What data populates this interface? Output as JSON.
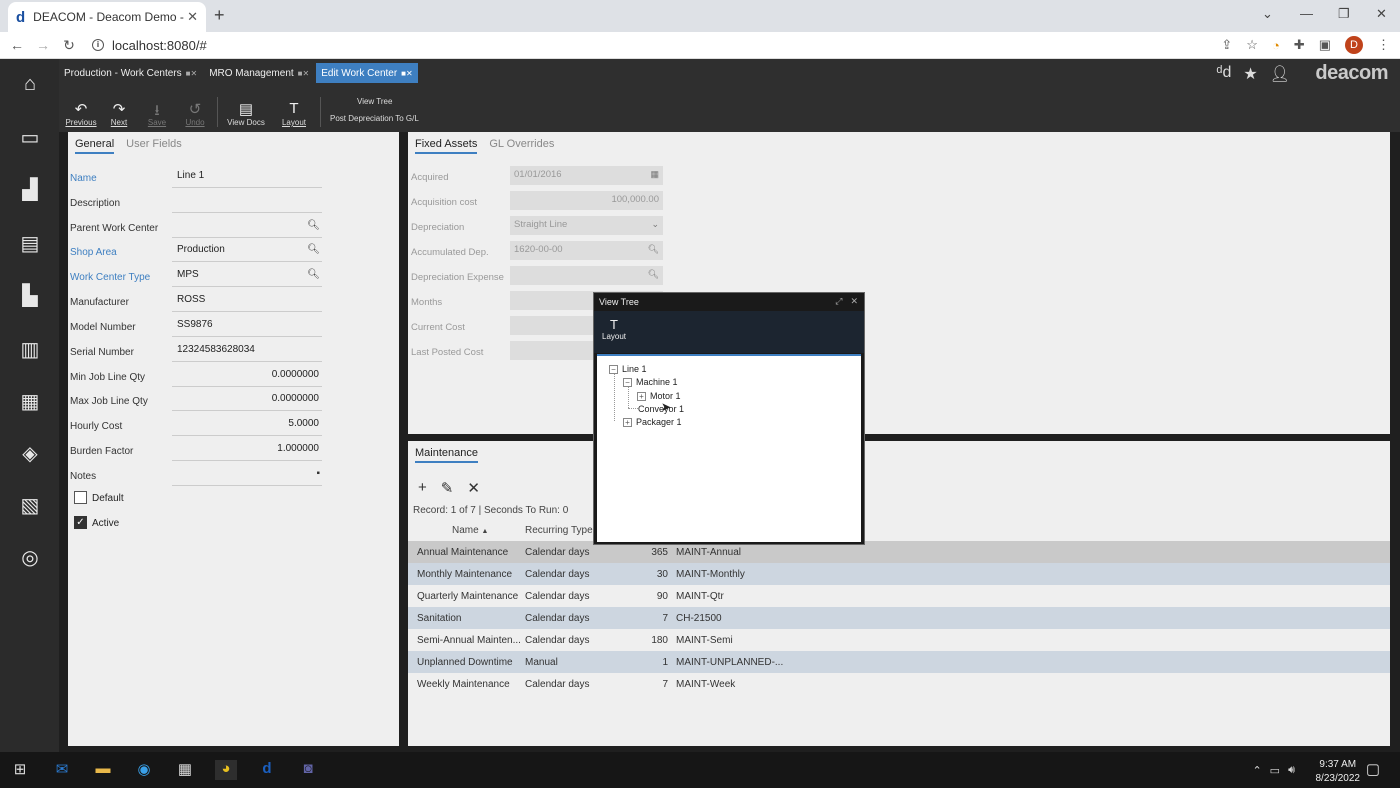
{
  "browser": {
    "tab_title": "DEACOM - Deacom Demo - Edit",
    "favicon_letter": "d",
    "url": "localhost:8080/#",
    "profile_initial": "D"
  },
  "app": {
    "brand": "deacom",
    "tabs": [
      {
        "label": "Production - Work Centers"
      },
      {
        "label": "MRO Management"
      },
      {
        "label": "Edit Work Center"
      }
    ],
    "ribbon": {
      "previous": "Previous",
      "next": "Next",
      "save": "Save",
      "undo": "Undo",
      "view_docs": "View Docs",
      "layout": "Layout",
      "view_tree": "View Tree",
      "post_depreciation": "Post Depreciation To G/L"
    }
  },
  "general": {
    "tabs": [
      "General",
      "User Fields"
    ],
    "fields": {
      "name": {
        "label": "Name",
        "value": "Line 1"
      },
      "description": {
        "label": "Description",
        "value": ""
      },
      "parent": {
        "label": "Parent Work Center",
        "value": ""
      },
      "shop_area": {
        "label": "Shop Area",
        "value": "Production"
      },
      "wc_type": {
        "label": "Work Center Type",
        "value": "MPS"
      },
      "manufacturer": {
        "label": "Manufacturer",
        "value": "ROSS"
      },
      "model": {
        "label": "Model Number",
        "value": "SS9876"
      },
      "serial": {
        "label": "Serial Number",
        "value": "12324583628034"
      },
      "min_qty": {
        "label": "Min Job Line Qty",
        "value": "0.0000000"
      },
      "max_qty": {
        "label": "Max Job Line Qty",
        "value": "0.0000000"
      },
      "hourly_cost": {
        "label": "Hourly Cost",
        "value": "5.0000"
      },
      "burden": {
        "label": "Burden Factor",
        "value": "1.000000"
      },
      "notes": {
        "label": "Notes",
        "value": ""
      }
    },
    "default_label": "Default",
    "default_checked": false,
    "active_label": "Active",
    "active_checked": true
  },
  "fixed_assets": {
    "tabs": [
      "Fixed Assets",
      "GL Overrides"
    ],
    "acquired": {
      "label": "Acquired",
      "value": "01/01/2016"
    },
    "acq_cost": {
      "label": "Acquisition cost",
      "value": "100,000.00"
    },
    "depreciation": {
      "label": "Depreciation",
      "value": "Straight Line"
    },
    "accum_dep": {
      "label": "Accumulated Dep.",
      "value": "1620-00-00"
    },
    "dep_expense": {
      "label": "Depreciation Expense",
      "value": ""
    },
    "months": {
      "label": "Months",
      "value": ""
    },
    "current_cost": {
      "label": "Current Cost",
      "value": ""
    },
    "last_posted": {
      "label": "Last Posted Cost",
      "value": ""
    }
  },
  "maintenance": {
    "title": "Maintenance",
    "record_info": "Record: 1 of 7 |  Seconds To Run: 0",
    "columns": {
      "name": "Name",
      "recurring": "Recurring Type"
    },
    "rows": [
      {
        "name": "Annual Maintenance",
        "type": "Calendar days",
        "interval": "365",
        "code": "MAINT-Annual"
      },
      {
        "name": "Monthly Maintenance",
        "type": "Calendar days",
        "interval": "30",
        "code": "MAINT-Monthly"
      },
      {
        "name": "Quarterly Maintenance",
        "type": "Calendar days",
        "interval": "90",
        "code": "MAINT-Qtr"
      },
      {
        "name": "Sanitation",
        "type": "Calendar days",
        "interval": "7",
        "code": "CH-21500"
      },
      {
        "name": "Semi-Annual Mainten...",
        "type": "Calendar days",
        "interval": "180",
        "code": "MAINT-Semi"
      },
      {
        "name": "Unplanned Downtime",
        "type": "Manual",
        "interval": "1",
        "code": "MAINT-UNPLANNED-..."
      },
      {
        "name": "Weekly Maintenance",
        "type": "Calendar days",
        "interval": "7",
        "code": "MAINT-Week"
      }
    ]
  },
  "view_tree": {
    "title": "View Tree",
    "layout": "Layout",
    "nodes": {
      "line1": "Line 1",
      "machine1": "Machine 1",
      "motor1": "Motor 1",
      "conveyor1": "Conveyor 1",
      "packager1": "Packager 1"
    }
  },
  "taskbar": {
    "time": "9:37 AM",
    "date": "8/23/2022"
  }
}
